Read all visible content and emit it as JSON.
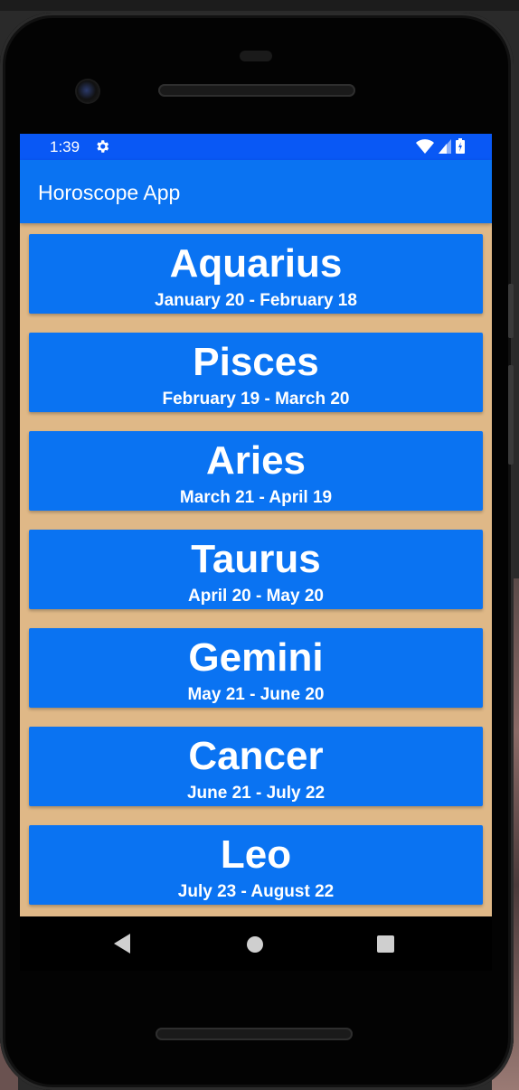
{
  "status_bar": {
    "time": "1:39",
    "icons": [
      "gear-icon",
      "wifi-icon",
      "signal-icon",
      "battery-icon"
    ]
  },
  "app_bar": {
    "title": "Horoscope App"
  },
  "signs": [
    {
      "name": "Aquarius",
      "dates": "January 20 - February 18"
    },
    {
      "name": "Pisces",
      "dates": "February 19 - March 20"
    },
    {
      "name": "Aries",
      "dates": "March 21 - April 19"
    },
    {
      "name": "Taurus",
      "dates": "April 20 - May 20"
    },
    {
      "name": "Gemini",
      "dates": "May 21 - June 20"
    },
    {
      "name": "Cancer",
      "dates": "June 21 - July 22"
    },
    {
      "name": "Leo",
      "dates": "July 23 - August 22"
    }
  ],
  "nav_bar": {
    "buttons": [
      "back-icon",
      "home-icon",
      "recents-icon"
    ]
  },
  "colors": {
    "status_bar": "#0958f5",
    "app_bar": "#0a73f2",
    "card": "#0a73f2",
    "list_background": "#dfb887",
    "text": "#ffffff"
  }
}
